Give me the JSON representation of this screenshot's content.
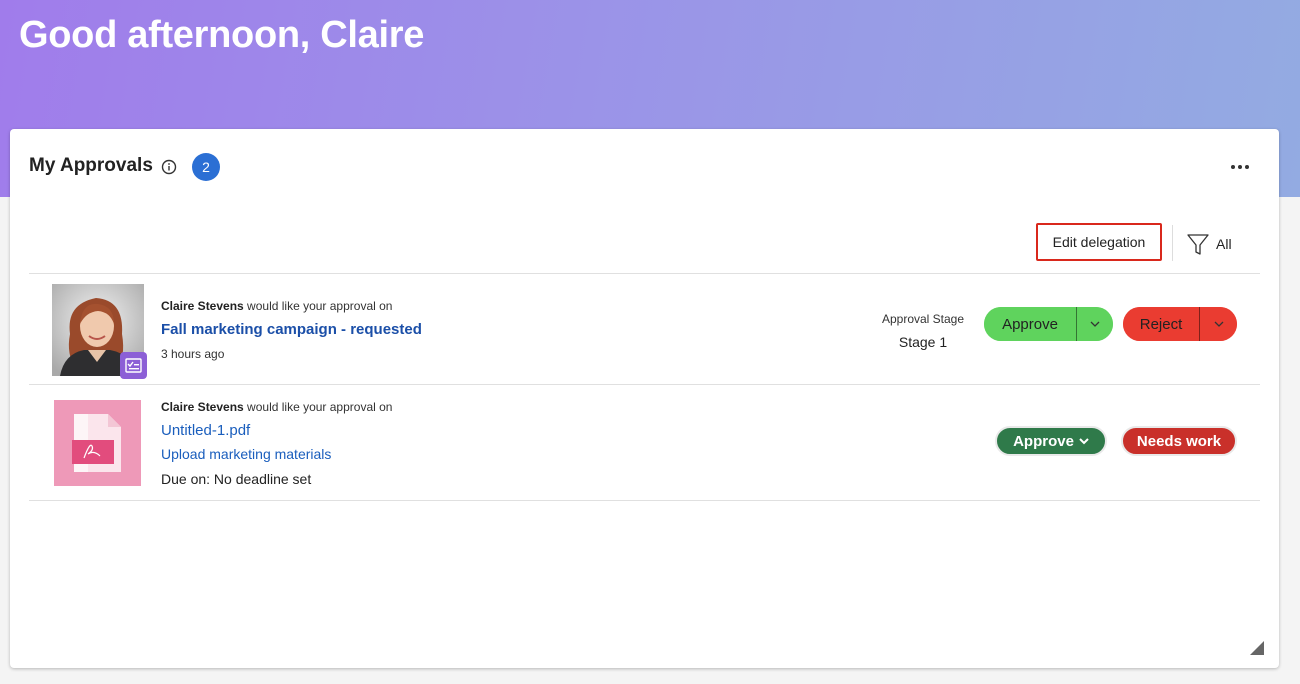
{
  "greeting": "Good afternoon, Claire",
  "card": {
    "title": "My Approvals",
    "count": "2"
  },
  "toolbar": {
    "edit_delegation_label": "Edit delegation",
    "filter_label": "All"
  },
  "approvals": [
    {
      "requester": "Claire Stevens",
      "request_text": " would like your approval on",
      "item_title": "Fall marketing campaign - requested",
      "time_ago": "3 hours ago",
      "stage_label": "Approval Stage",
      "stage_value": "Stage 1",
      "approve_label": "Approve",
      "reject_label": "Reject"
    },
    {
      "requester": "Claire Stevens",
      "request_text": " would like your approval on",
      "file_name": "Untitled-1.pdf",
      "task_name": "Upload marketing materials",
      "due": "Due on: No deadline set",
      "approve_label": "Approve",
      "needs_work_label": "Needs work"
    }
  ],
  "colors": {
    "approve_light": "#5fd35d",
    "reject_light": "#ea3c31",
    "approve_dark": "#2f7a4a",
    "needs_work": "#c9302a",
    "link": "#1a5ebd",
    "badge_blue": "#2b6fd4",
    "highlight_red": "#d9281c"
  }
}
